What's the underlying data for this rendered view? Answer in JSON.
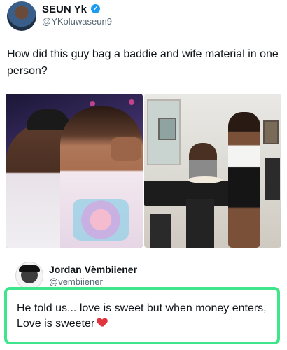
{
  "post": {
    "author_name": "SEUN Yk",
    "author_handle": "@YKoluwaseun9",
    "verified": true,
    "text": "How did this guy bag a baddie and wife material in one person?",
    "images": [
      {
        "alt_semantic": "couple-selfie-photo"
      },
      {
        "alt_semantic": "woman-serving-food-at-dining-table-photo"
      }
    ]
  },
  "quote": {
    "author_name": "Jordan Vèmbiiener",
    "author_handle": "@vembiiener",
    "text_line1": "He told us... love is sweet but when money enters,",
    "text_line2": "Love is sweeter",
    "emoji": "red-heart-icon",
    "highlight_color": "#3ee58a"
  },
  "colors": {
    "text_primary": "#0f1419",
    "text_secondary": "#536471",
    "verified_blue": "#1d9bf0",
    "heart_red": "#e0343e"
  }
}
